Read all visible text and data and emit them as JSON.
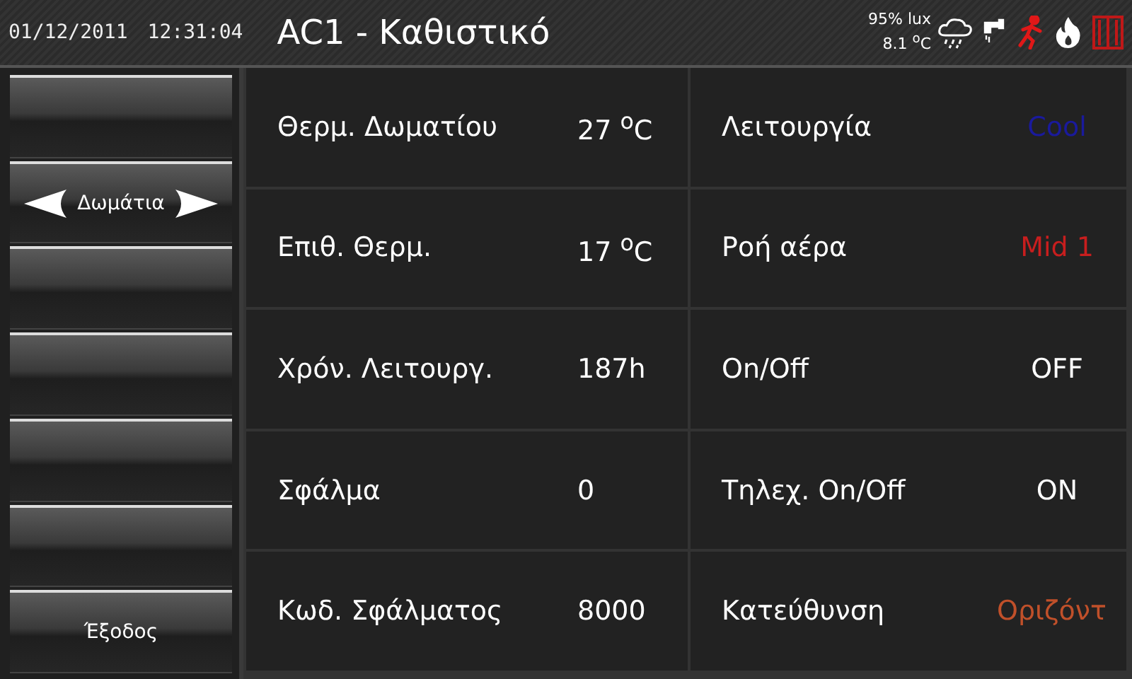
{
  "header": {
    "date": "01/12/2011",
    "time": "12:31:04",
    "title": "AC1 - Καθιστικό",
    "humidity": "95% lux",
    "outdoor_temp": "8.1 $^{o}$C"
  },
  "sidebar": [
    {
      "kind": "blank"
    },
    {
      "kind": "nav",
      "label": "Δωμάτια"
    },
    {
      "kind": "blank"
    },
    {
      "kind": "blank"
    },
    {
      "kind": "blank"
    },
    {
      "kind": "blank"
    },
    {
      "kind": "plain",
      "label": "Έξοδος"
    }
  ],
  "readings": [
    {
      "label": "Θερμ. Δωματίου",
      "value": "27 $^{o}$C"
    },
    {
      "label": "Επιθ. Θερμ.",
      "value": "17 $^{o}$C"
    },
    {
      "label": "Χρόν. Λειτουργ.",
      "value": "187h"
    },
    {
      "label": "Σφάλμα",
      "value": "0"
    },
    {
      "label": "Κωδ. Σφάλματος",
      "value": "8000"
    }
  ],
  "settings": [
    {
      "label": "Λειτουργία",
      "value": "Cool",
      "color": "#1a1a9c"
    },
    {
      "label": "Ροή αέρα",
      "value": "Mid 1",
      "color": "#c81e1e"
    },
    {
      "label": "On/Off",
      "value": "OFF",
      "color": "#ffffff"
    },
    {
      "label": "Τηλεχ. On/Off",
      "value": "ON",
      "color": "#ffffff"
    },
    {
      "label": "Κατεύθυνση",
      "value": "Οριζόντ",
      "color": "#c0502a"
    }
  ]
}
